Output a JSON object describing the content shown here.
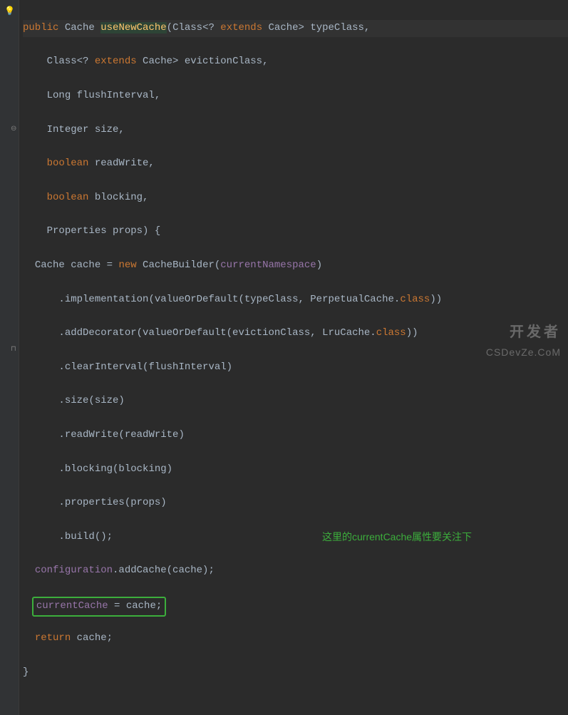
{
  "code": {
    "public": "public",
    "cache_type": "Cache",
    "method_name": "useNewCache",
    "param1a": "Class<? ",
    "extends": "extends",
    "param1b": " Cache> typeClass,",
    "param2a": "Class<? ",
    "param2b": " Cache> evictionClass,",
    "param3": "Long flushInterval,",
    "param4": "Integer size,",
    "boolean": "boolean",
    "param5b": " readWrite,",
    "param6b": " blocking,",
    "param7": "Properties props) {",
    "lineA": "Cache cache = ",
    "new": "new",
    "lineAb": " CacheBuilder(",
    "currentNamespace": "currentNamespace",
    "rparen": ")",
    "lineB": ".implementation(valueOrDefault(typeClass, PerpetualCache.",
    "class": "class",
    "dparen": "))",
    "lineC": ".addDecorator(valueOrDefault(evictionClass, LruCache.",
    "lineD": ".clearInterval(flushInterval)",
    "lineE": ".size(size)",
    "lineF": ".readWrite(readWrite)",
    "lineG": ".blocking(blocking)",
    "lineH": ".properties(props)",
    "lineI": ".build();",
    "lineJa": "configuration",
    "lineJb": ".addCache(cache);",
    "lineKa": "currentCache",
    "lineKb": " = cache;",
    "return": "return",
    "lineLb": " cache;",
    "brace": "}"
  },
  "annotation": "这里的currentCache属性要关注下",
  "watermark": {
    "line1": "开发者",
    "line2": "CSDevZe.CoM"
  }
}
